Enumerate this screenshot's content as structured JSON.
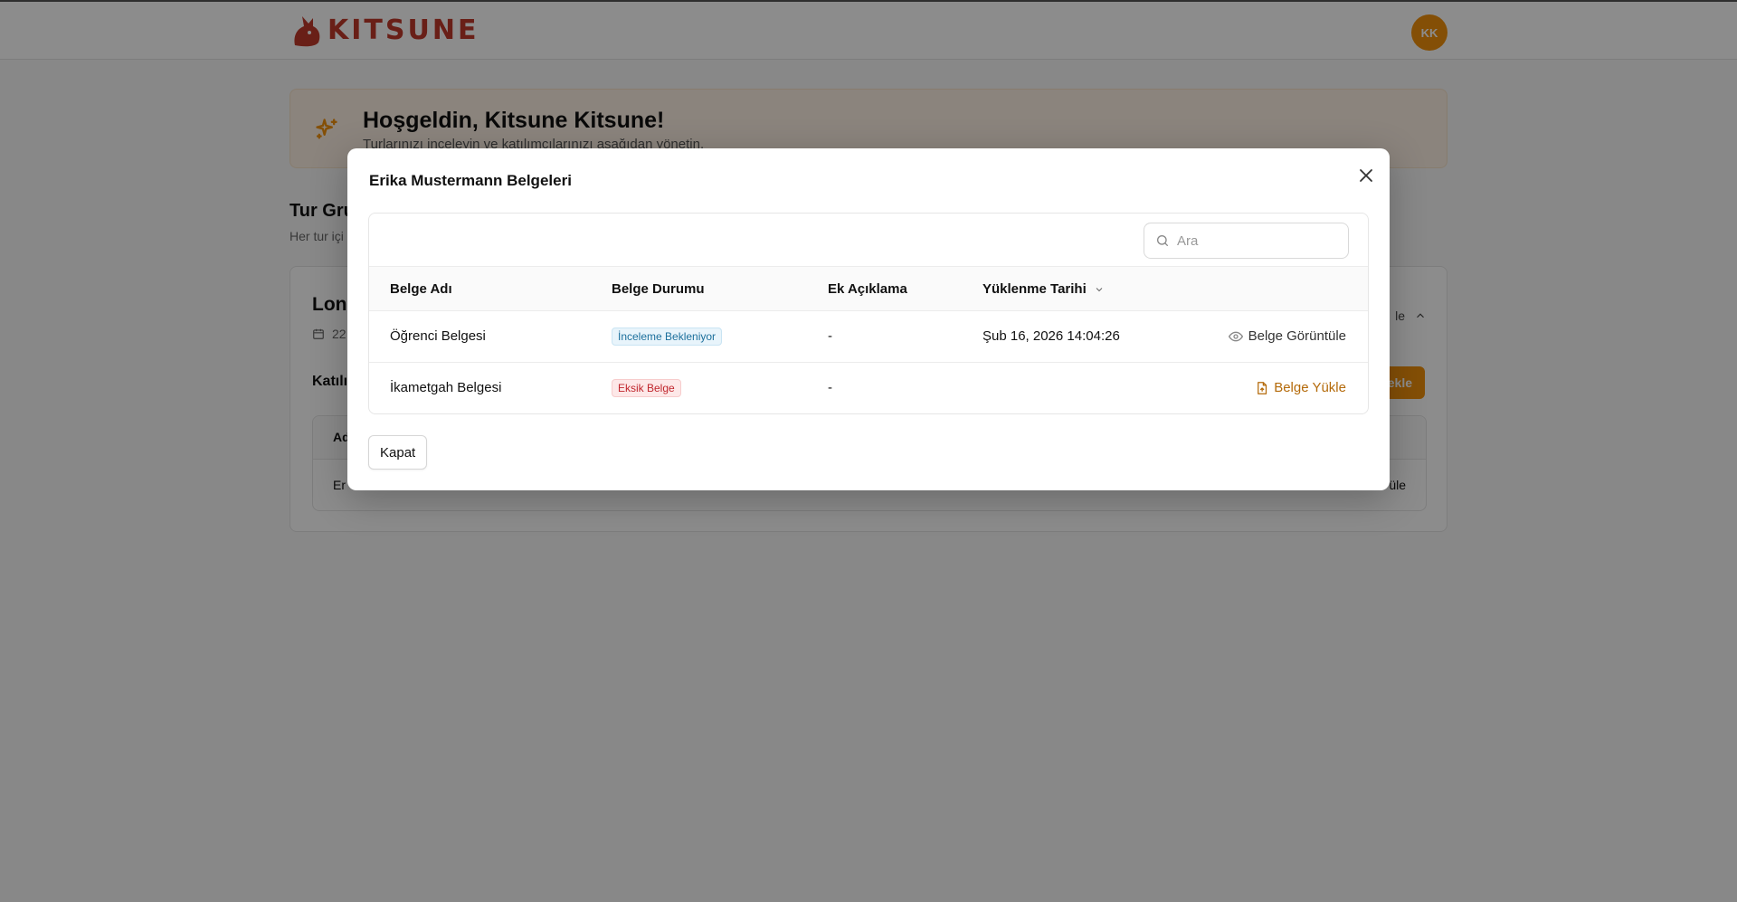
{
  "brand": {
    "name": "KITSUNE",
    "color": "#c0392b"
  },
  "user": {
    "initials": "KK",
    "avatar_color": "#f0900c"
  },
  "welcome": {
    "title": "Hoşgeldin, Kitsune Kitsune!",
    "subtitle": "Turlarınızı inceleyin ve katılımcılarınızı aşağıdan yönetin.",
    "icon": "sparkles-icon"
  },
  "section": {
    "title": "Tur Gru",
    "subtitle": "Her tur içi"
  },
  "tour": {
    "name": "Lond",
    "date": "22",
    "toggle_label": "le",
    "participants_title": "Katılı",
    "add_button": "ekle",
    "table_header": "Ad",
    "row_name": "Er",
    "row_action": "üle"
  },
  "modal": {
    "title": "Erika Mustermann Belgeleri",
    "search_placeholder": "Ara",
    "columns": {
      "name": "Belge Adı",
      "status": "Belge Durumu",
      "note": "Ek Açıklama",
      "date": "Yüklenme Tarihi"
    },
    "rows": [
      {
        "name": "Öğrenci Belgesi",
        "status": "İnceleme Bekleniyor",
        "note": "-",
        "date": "Şub 16, 2026 14:04:26",
        "action": "Belge Görüntüle"
      },
      {
        "name": "İkametgah Belgesi",
        "status": "Eksik Belge",
        "note": "-",
        "date": "",
        "action": "Belge Yükle"
      }
    ],
    "close_button": "Kapat"
  },
  "colors": {
    "accent": "#f0900c",
    "status_review": "#1c6f9c",
    "status_missing": "#c0262d",
    "upload_action": "#b46a0a"
  }
}
